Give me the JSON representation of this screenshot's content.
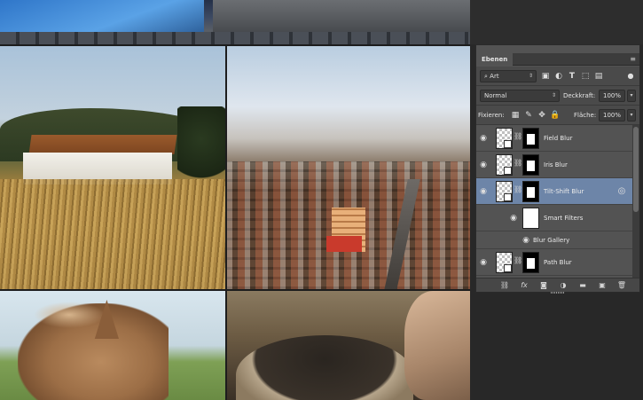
{
  "panel": {
    "tab_label": "Ebenen",
    "close_glyph": "×",
    "collapse_glyph": "»",
    "menu_glyph": "≡",
    "filter": {
      "kind_value": "Art"
    },
    "blend_mode": "Normal",
    "opacity_label": "Deckkraft:",
    "opacity_value": "100%",
    "lock_label": "Fixieren:",
    "fill_label": "Fläche:",
    "fill_value": "100%"
  },
  "layers": [
    {
      "name": "Field Blur",
      "visible": true,
      "selected": false
    },
    {
      "name": "Iris Blur",
      "visible": true,
      "selected": false
    },
    {
      "name": "Tilt-Shift Blur",
      "visible": true,
      "selected": true
    },
    {
      "name": "Smart Filters",
      "visible": true,
      "selected": false,
      "kind": "filter-mask"
    },
    {
      "name": "Blur Gallery",
      "visible": true,
      "selected": false,
      "kind": "filter"
    },
    {
      "name": "Path Blur",
      "visible": true,
      "selected": false
    }
  ],
  "icons": {
    "eye": "👁",
    "chain": "⛓",
    "filter_type": [
      "pixel-layer-filter-icon",
      "adjustment-filter-icon",
      "type-filter-icon",
      "shape-filter-icon",
      "smart-object-filter-icon"
    ],
    "locks": [
      "lock-transparent-icon",
      "lock-brush-icon",
      "lock-move-icon",
      "lock-all-icon"
    ],
    "bottom": [
      "link-layers-icon",
      "fx-icon",
      "add-mask-icon",
      "new-fill-adjustment-icon",
      "new-group-icon",
      "new-layer-icon",
      "delete-layer-icon"
    ]
  },
  "colors": {
    "selection": "#6d85a8",
    "panel_bg": "#535353"
  }
}
